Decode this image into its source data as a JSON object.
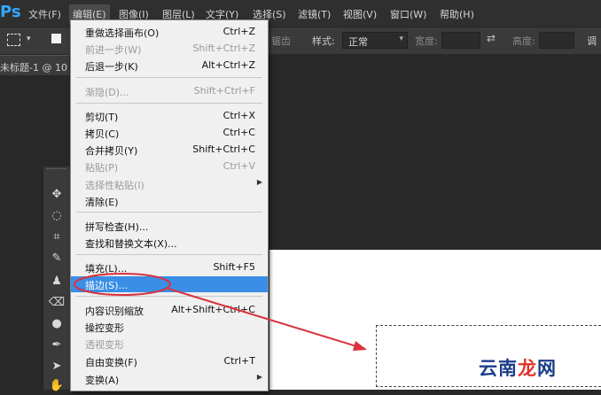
{
  "app": {
    "logo": "Ps"
  },
  "menubar": {
    "items": [
      "文件(F)",
      "编辑(E)",
      "图像(I)",
      "图层(L)",
      "文字(Y)",
      "选择(S)",
      "滤镜(T)",
      "视图(V)",
      "窗口(W)",
      "帮助(H)"
    ],
    "active": "编辑(E)"
  },
  "options": {
    "anti_alias": "锯齿",
    "style_label": "样式:",
    "style_value": "正常",
    "width_label": "宽度:",
    "height_label": "高度:",
    "right_cut": "调"
  },
  "document": {
    "tab_title": "未标题-1 @ 10"
  },
  "edit_menu": {
    "items": [
      {
        "label": "重做选择画布(O)",
        "shortcut": "Ctrl+Z",
        "enabled": true
      },
      {
        "label": "前进一步(W)",
        "shortcut": "Shift+Ctrl+Z",
        "enabled": false
      },
      {
        "label": "后退一步(K)",
        "shortcut": "Alt+Ctrl+Z",
        "enabled": true
      },
      {
        "label": "渐隐(D)...",
        "shortcut": "Shift+Ctrl+F",
        "enabled": false
      },
      {
        "label": "剪切(T)",
        "shortcut": "Ctrl+X",
        "enabled": true
      },
      {
        "label": "拷贝(C)",
        "shortcut": "Ctrl+C",
        "enabled": true
      },
      {
        "label": "合并拷贝(Y)",
        "shortcut": "Shift+Ctrl+C",
        "enabled": true
      },
      {
        "label": "粘贴(P)",
        "shortcut": "Ctrl+V",
        "enabled": false
      },
      {
        "label": "选择性粘贴(I)",
        "shortcut": "",
        "enabled": false
      },
      {
        "label": "清除(E)",
        "shortcut": "",
        "enabled": true
      },
      {
        "label": "拼写检查(H)...",
        "shortcut": "",
        "enabled": true
      },
      {
        "label": "查找和替换文本(X)...",
        "shortcut": "",
        "enabled": true
      },
      {
        "label": "填充(L)...",
        "shortcut": "Shift+F5",
        "enabled": true
      },
      {
        "label": "描边(S)...",
        "shortcut": "",
        "enabled": true,
        "highlighted": true
      },
      {
        "label": "内容识别缩放",
        "shortcut": "Alt+Shift+Ctrl+C",
        "enabled": true
      },
      {
        "label": "操控变形",
        "shortcut": "",
        "enabled": true
      },
      {
        "label": "透视变形",
        "shortcut": "",
        "enabled": false
      },
      {
        "label": "自由变换(F)",
        "shortcut": "Ctrl+T",
        "enabled": true
      },
      {
        "label": "变换(A)",
        "shortcut": "",
        "enabled": true
      }
    ]
  },
  "watermark": {
    "text_a": "云南",
    "text_b": "龙",
    "text_c": "网"
  },
  "colors": {
    "accent": "#3a8ee6",
    "annotation": "#d8323c",
    "ps_blue": "#31a8ff"
  }
}
